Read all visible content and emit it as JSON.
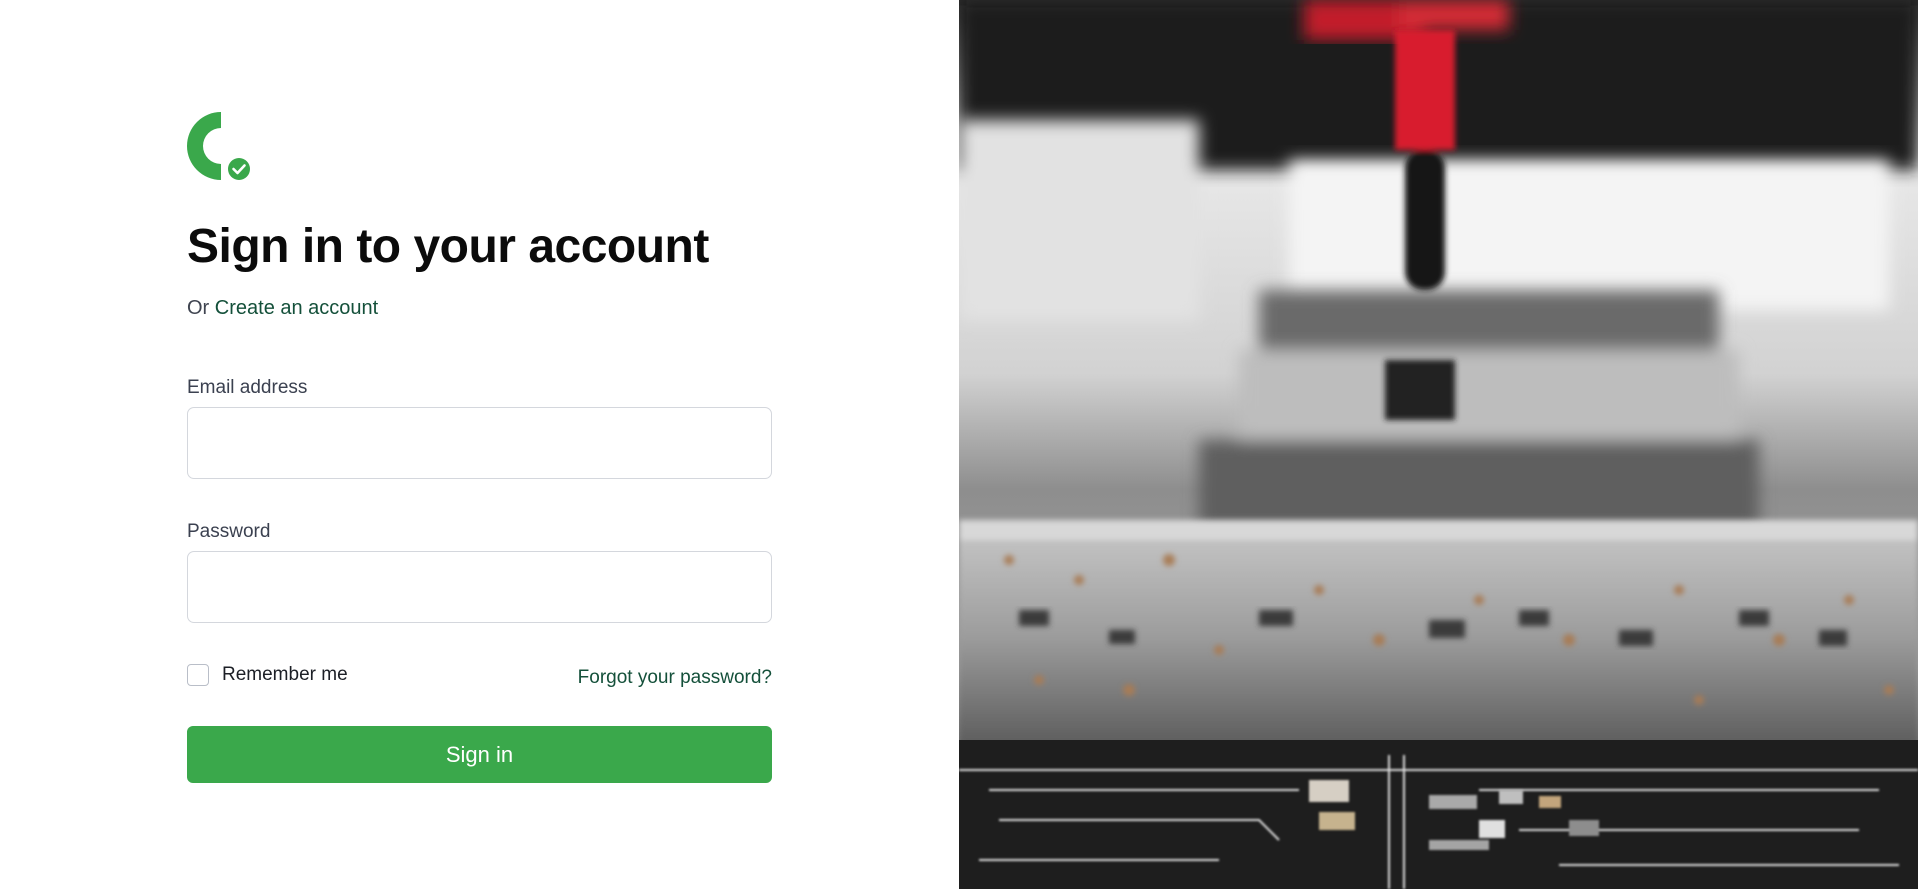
{
  "page": {
    "heading": "Sign in to your account",
    "sub_prefix": "Or",
    "create_account_link": "Create an account"
  },
  "form": {
    "email_label": "Email address",
    "email_value": "",
    "password_label": "Password",
    "password_value": "",
    "remember_label": "Remember me",
    "remember_checked": false,
    "forgot_link": "Forgot your password?",
    "submit_label": "Sign in"
  },
  "brand": {
    "logo_icon": "c-checkmark-logo-icon",
    "accent": "#3aa84b",
    "link_color": "#14503a"
  },
  "hero": {
    "image_icon": "circuit-board-photo"
  }
}
